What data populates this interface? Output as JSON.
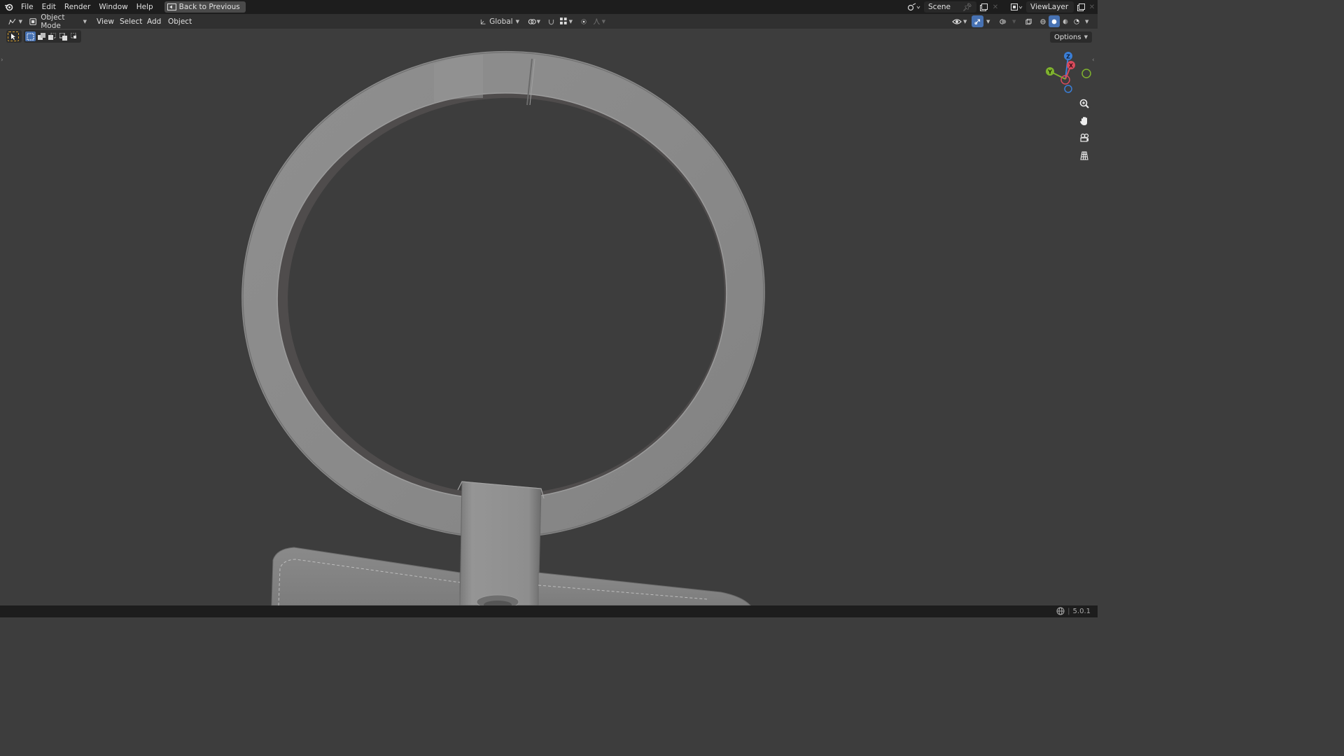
{
  "topbar": {
    "menus": [
      "File",
      "Edit",
      "Render",
      "Window",
      "Help"
    ],
    "back_button": "Back to Previous",
    "scene": "Scene",
    "view_layer": "ViewLayer"
  },
  "header": {
    "mode": "Object Mode",
    "menus": [
      "View",
      "Select",
      "Add",
      "Object"
    ],
    "orientation": "Global"
  },
  "viewport": {
    "options_label": "Options",
    "gizmo_axes": {
      "x": "X",
      "y": "Y",
      "z": "Z"
    }
  },
  "status": {
    "version": "5.0.1"
  },
  "colors": {
    "accent": "#4772b3",
    "background": "#3d3d3d",
    "topbar": "#1d1d1d",
    "x_axis": "#d94b5c",
    "y_axis": "#7fb22e",
    "z_axis": "#3a7fd8"
  },
  "icons": [
    "blender-logo-icon",
    "editor-type-icon",
    "object-mode-icon",
    "transform-orientation-icon",
    "pivot-icon",
    "snap-icon",
    "proportional-edit-icon",
    "visibility-icon",
    "gizmo-icon",
    "overlay-icon",
    "xray-icon",
    "wireframe-shading-icon",
    "solid-shading-icon",
    "material-shading-icon",
    "rendered-shading-icon",
    "zoom-icon",
    "pan-hand-icon",
    "camera-icon",
    "grid-icon"
  ]
}
